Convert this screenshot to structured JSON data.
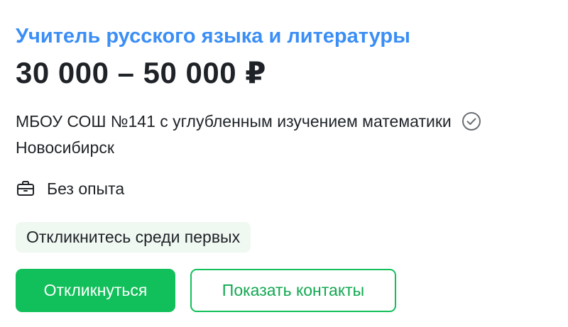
{
  "vacancy": {
    "title": "Учитель русского языка и литературы",
    "salary": "30 000 – 50 000 ₽",
    "company": "МБОУ СОШ №141 с углубленным изучением математики",
    "company_verified_icon": "check-circle-icon",
    "city": "Новосибирск",
    "experience_icon": "briefcase-icon",
    "experience": "Без опыта",
    "badge": "Откликнитесь среди первых"
  },
  "actions": {
    "respond_label": "Откликнуться",
    "show_contacts_label": "Показать контакты"
  },
  "colors": {
    "title": "#3a8ef6",
    "primary": "#11c05a",
    "badge_bg": "#f0f8f2",
    "text": "#1f2328"
  }
}
